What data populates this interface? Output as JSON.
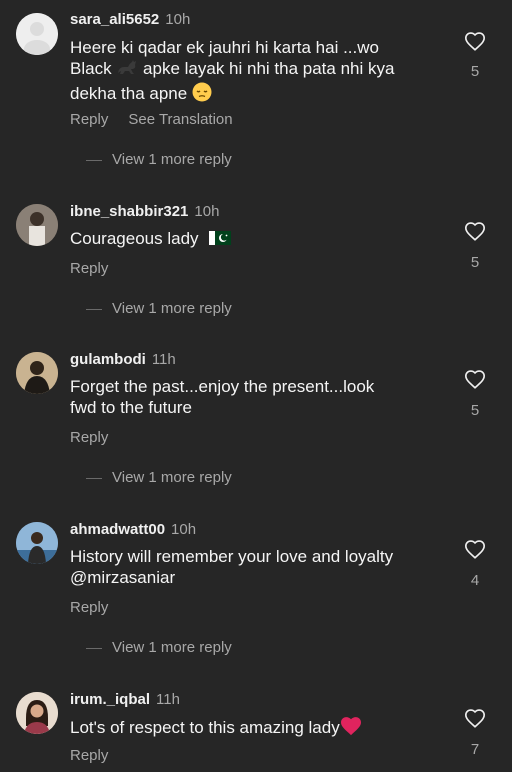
{
  "comments": [
    {
      "username": "sara_ali5652",
      "time": "10h",
      "text_line1": "Heere ki qadar ek jauhri hi karta hai ...wo",
      "text_line2a": "Black",
      "text_line2b": "apke layak hi nhi tha pata nhi kya",
      "text_line3": "dekha tha apne",
      "reply": "Reply",
      "translate": "See Translation",
      "likes": "5",
      "view_more": "View 1 more reply",
      "icons": [
        "cat-emoji-icon",
        "pensive-face-emoji-icon"
      ]
    },
    {
      "username": "ibne_shabbir321",
      "time": "10h",
      "text": "Courageous lady",
      "reply": "Reply",
      "likes": "5",
      "view_more": "View 1 more reply",
      "icons": [
        "pakistan-flag-icon"
      ]
    },
    {
      "username": "gulambodi",
      "time": "11h",
      "text_line1": "Forget the past...enjoy the present...look",
      "text_line2": "fwd to the future",
      "reply": "Reply",
      "likes": "5",
      "view_more": "View 1 more reply"
    },
    {
      "username": "ahmadwatt00",
      "time": "10h",
      "text_line1": "History will remember your love and loyalty",
      "text_line2": "@mirzasaniar",
      "reply": "Reply",
      "likes": "4",
      "view_more": "View 1 more reply"
    },
    {
      "username": "irum._iqbal",
      "time": "11h",
      "text": "Lot's of respect to this amazing lady",
      "reply": "Reply",
      "likes": "7",
      "icons": [
        "red-heart-emoji-icon"
      ]
    }
  ],
  "colors": {
    "background": "#262626",
    "text": "#f5f5f5",
    "secondary": "#a8a8a8",
    "heart_emoji": "#e0245e",
    "flag_green": "#01411c"
  }
}
